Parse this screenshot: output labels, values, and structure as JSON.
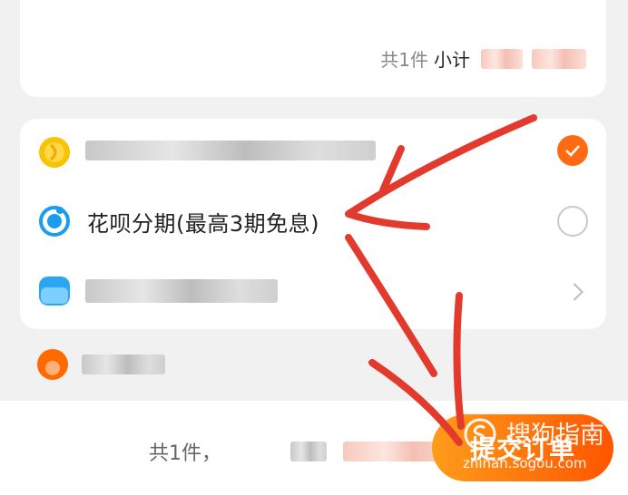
{
  "order_card": {
    "count": "共1件",
    "subtotal_label": "小计"
  },
  "payment": {
    "items": [
      {
        "name": "",
        "icon": "coin-icon",
        "state": "selected"
      },
      {
        "name": "花呗分期(最高3期免息)",
        "icon": "huabei-icon",
        "state": "unselected"
      },
      {
        "name": "",
        "icon": "card-icon",
        "state": "arrow"
      }
    ]
  },
  "footer": {
    "total_count": "共1件，",
    "submit_label": "提交订单"
  },
  "watermark": {
    "title": "搜狗指南",
    "url": "zhinan.sogou.com"
  },
  "colors": {
    "accent": "#ff6a12",
    "annotation": "#e23a2c"
  }
}
